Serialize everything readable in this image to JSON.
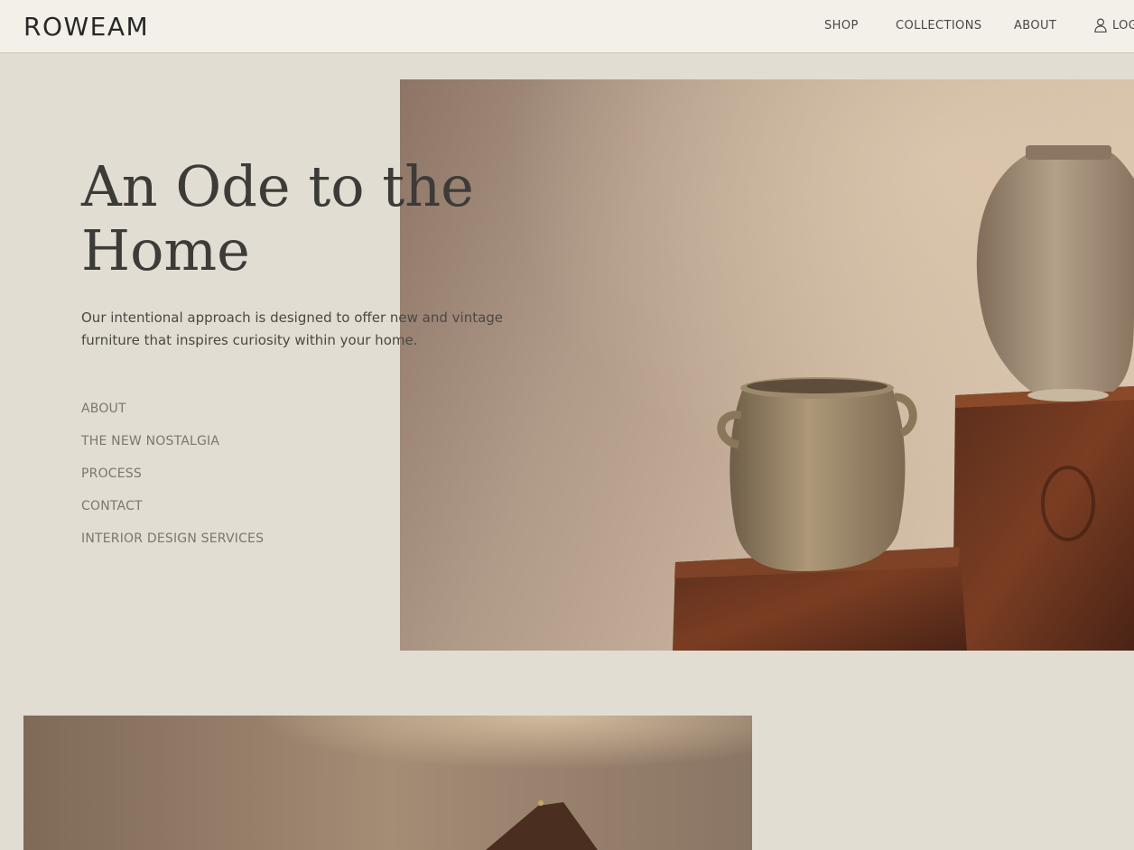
{
  "brand": {
    "name": "ROWEAM"
  },
  "top_nav": {
    "items": [
      "SHOP",
      "COLLECTIONS",
      "ABOUT"
    ],
    "login_label": "LOG"
  },
  "hero": {
    "headline_line1": "An Ode to the",
    "headline_line2": "Home",
    "intro": "Our intentional approach is designed to offer new and vintage furniture that inspires curiosity within your home."
  },
  "side_nav": {
    "items": [
      "ABOUT",
      "THE NEW NOSTALGIA",
      "PROCESS",
      "CONTACT",
      "INTERIOR DESIGN SERVICES"
    ]
  },
  "colors": {
    "page_bg": "#e2ddd2",
    "header_bg": "#f3f0ea",
    "text": "#3d3b38",
    "muted_link": "#7a7670"
  },
  "icons": {
    "login": "user-icon"
  }
}
